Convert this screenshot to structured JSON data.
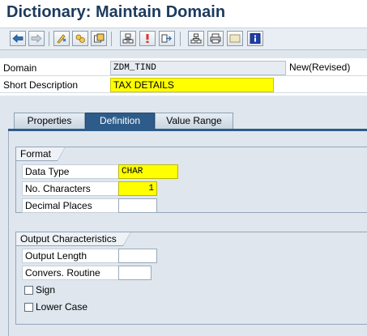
{
  "window": {
    "title": "Dictionary: Maintain Domain"
  },
  "toolbar": {
    "buttons": [
      {
        "icon": "back-arrow-icon"
      },
      {
        "icon": "forward-arrow-icon"
      },
      {
        "icon": "display-change-icon"
      },
      {
        "icon": "check-icon"
      },
      {
        "icon": "activate-icon"
      },
      {
        "icon": "where-used-icon"
      },
      {
        "icon": "info-marker-icon"
      },
      {
        "icon": "hierarchy-icon"
      },
      {
        "icon": "tree-icon"
      },
      {
        "icon": "print-icon"
      },
      {
        "icon": "frame-icon"
      },
      {
        "icon": "info-icon"
      }
    ]
  },
  "header": {
    "domain_label": "Domain",
    "domain_value": "ZDM_TIND",
    "status": "New(Revised)",
    "short_desc_label": "Short Description",
    "short_desc_value": "TAX DETAILS"
  },
  "tabs": [
    {
      "label": "Properties",
      "active": false
    },
    {
      "label": "Definition",
      "active": true
    },
    {
      "label": "Value Range",
      "active": false
    }
  ],
  "format": {
    "title": "Format",
    "data_type_label": "Data Type",
    "data_type_value": "CHAR",
    "no_chars_label": "No. Characters",
    "no_chars_value": "1",
    "decimal_label": "Decimal Places",
    "decimal_value": ""
  },
  "output": {
    "title": "Output Characteristics",
    "output_length_label": "Output Length",
    "output_length_value": "",
    "convers_routine_label": "Convers. Routine",
    "convers_routine_value": "",
    "sign_label": "Sign",
    "lower_case_label": "Lower Case"
  },
  "colors": {
    "accent": "#2e5c8a",
    "title": "#1c3a5e",
    "highlight": "#ffff00"
  }
}
